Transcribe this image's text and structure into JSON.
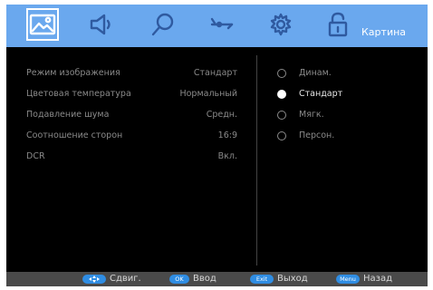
{
  "header": {
    "title": "Картина",
    "tabs": [
      {
        "icon": "picture-icon",
        "active": true
      },
      {
        "icon": "speaker-icon",
        "active": false
      },
      {
        "icon": "search-icon",
        "active": false
      },
      {
        "icon": "antenna-icon",
        "active": false
      },
      {
        "icon": "gear-icon",
        "active": false
      },
      {
        "icon": "lock-icon",
        "active": false
      }
    ]
  },
  "settings": [
    {
      "label": "Режим изображения",
      "value": "Стандарт"
    },
    {
      "label": "Цветовая температура",
      "value": "Нормальный"
    },
    {
      "label": "Подавление шума",
      "value": "Средн."
    },
    {
      "label": "Соотношение сторон",
      "value": "16:9"
    },
    {
      "label": "DCR",
      "value": "Вкл."
    }
  ],
  "options": [
    {
      "label": "Динам.",
      "selected": false
    },
    {
      "label": "Стандарт",
      "selected": true
    },
    {
      "label": "Мягк.",
      "selected": false
    },
    {
      "label": "Персон.",
      "selected": false
    }
  ],
  "footer": {
    "hints": [
      {
        "key": "",
        "key_icon": "move-arrows-icon",
        "text": "Сдвиг."
      },
      {
        "key": "OK",
        "text": "Ввод"
      },
      {
        "key": "Exit",
        "text": "Выход"
      },
      {
        "key": "Menu",
        "text": "Назад"
      }
    ]
  },
  "colors": {
    "header_bg": "#6aa8ee",
    "screen_bg": "#000000",
    "footer_bg": "#4a4a4a",
    "badge_bg": "#2f8de3",
    "inactive_icon": "#2f5aa0"
  }
}
